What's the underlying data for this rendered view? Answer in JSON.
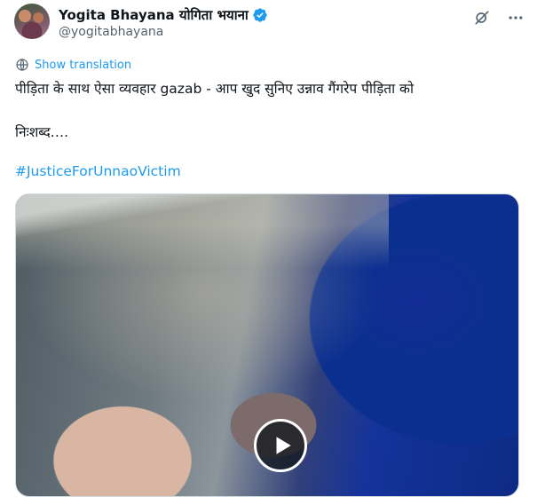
{
  "author": {
    "display_name": "Yogita Bhayana योगिता भयाना",
    "handle": "@yogitabhayana",
    "verified": true
  },
  "icons": {
    "verified": "verified-badge-icon",
    "grok": "grok-icon",
    "more": "more-icon",
    "translate": "globe-icon",
    "play": "play-icon"
  },
  "translation": {
    "label": "Show translation"
  },
  "tweet": {
    "line1": "पीड़िता के साथ ऐसा व्यवहार gazab - आप खुद सुनिए उन्नाव गैंगरेप पीड़िता को",
    "line2": "निःशब्द….",
    "hashtag": "#JusticeForUnnaoVictim"
  },
  "colors": {
    "accent": "#1d9bf0",
    "text": "#0f1419",
    "secondary": "#536471"
  }
}
